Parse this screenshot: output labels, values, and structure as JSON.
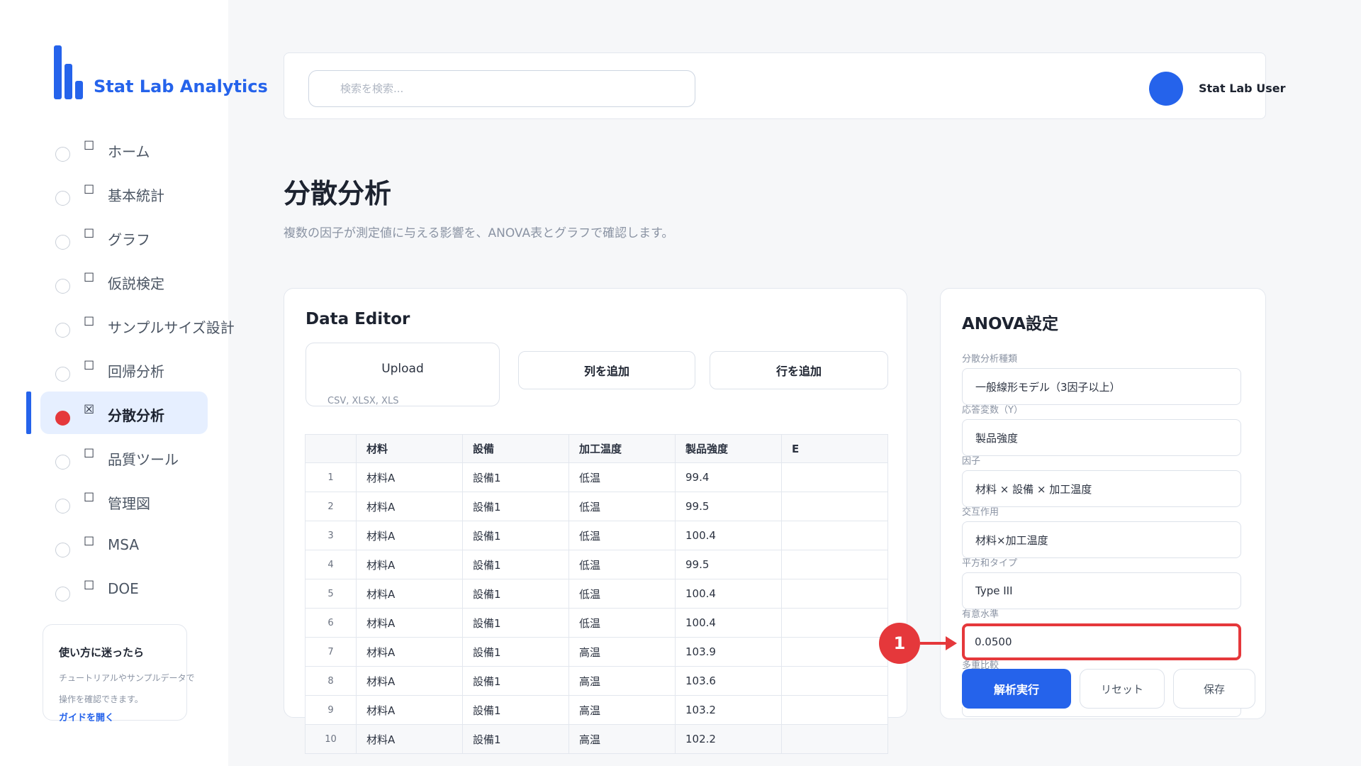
{
  "app": {
    "name": "Stat Lab Analytics"
  },
  "colors": {
    "accent": "#2563eb",
    "highlight": "#e5383b"
  },
  "sidebar": {
    "items": [
      {
        "label": "ホーム",
        "icon": "☐",
        "active": false
      },
      {
        "label": "基本統計",
        "icon": "☐",
        "active": false
      },
      {
        "label": "グラフ",
        "icon": "☐",
        "active": false
      },
      {
        "label": "仮説検定",
        "icon": "☐",
        "active": false
      },
      {
        "label": "サンプルサイズ設計",
        "icon": "☐",
        "active": false
      },
      {
        "label": "回帰分析",
        "icon": "☐",
        "active": false
      },
      {
        "label": "分散分析",
        "icon": "☒",
        "active": true
      },
      {
        "label": "品質ツール",
        "icon": "☐",
        "active": false
      },
      {
        "label": "管理図",
        "icon": "☐",
        "active": false
      },
      {
        "label": "MSA",
        "icon": "☐",
        "active": false
      },
      {
        "label": "DOE",
        "icon": "☐",
        "active": false
      }
    ],
    "help": {
      "title": "使い方に迷ったら",
      "description": "チュートリアルやサンプルデータで操作を確認できます。",
      "link": "ガイドを開く"
    }
  },
  "header": {
    "search_placeholder": "検索を検索...",
    "user_name": "Stat Lab User"
  },
  "page": {
    "title": "分散分析",
    "subtitle": "複数の因子が測定値に与える影響を、ANOVA表とグラフで確認します。"
  },
  "editor": {
    "title": "Data Editor",
    "upload_label": "Upload",
    "upload_hint": "CSV, XLSX, XLS",
    "add_column": "列を追加",
    "add_row": "行を追加",
    "columns": [
      "",
      "材料",
      "設備",
      "加工温度",
      "製品強度",
      "E"
    ],
    "rows": [
      [
        "1",
        "材料A",
        "設備1",
        "低温",
        "99.4",
        ""
      ],
      [
        "2",
        "材料A",
        "設備1",
        "低温",
        "99.5",
        ""
      ],
      [
        "3",
        "材料A",
        "設備1",
        "低温",
        "100.4",
        ""
      ],
      [
        "4",
        "材料A",
        "設備1",
        "低温",
        "99.5",
        ""
      ],
      [
        "5",
        "材料A",
        "設備1",
        "低温",
        "100.4",
        ""
      ],
      [
        "6",
        "材料A",
        "設備1",
        "低温",
        "100.4",
        ""
      ],
      [
        "7",
        "材料A",
        "設備1",
        "高温",
        "103.9",
        ""
      ],
      [
        "8",
        "材料A",
        "設備1",
        "高温",
        "103.6",
        ""
      ],
      [
        "9",
        "材料A",
        "設備1",
        "高温",
        "103.2",
        ""
      ],
      [
        "10",
        "材料A",
        "設備1",
        "高温",
        "102.2",
        ""
      ]
    ]
  },
  "anova": {
    "title": "ANOVA設定",
    "fields": [
      {
        "label": "分散分析種類",
        "value": "一般線形モデル（3因子以上）"
      },
      {
        "label": "応答変数（Y）",
        "value": "製品強度"
      },
      {
        "label": "因子",
        "value": "材料 × 設備 × 加工温度"
      },
      {
        "label": "交互作用",
        "value": "材料×加工温度"
      },
      {
        "label": "平方和タイプ",
        "value": "Type III"
      },
      {
        "label": "有意水準",
        "value": "0.0500"
      },
      {
        "label": "多重比較",
        "value": ""
      }
    ],
    "run_label": "解析実行",
    "reset_label": "リセット",
    "save_label": "保存"
  },
  "annotation": {
    "marker": "1"
  }
}
